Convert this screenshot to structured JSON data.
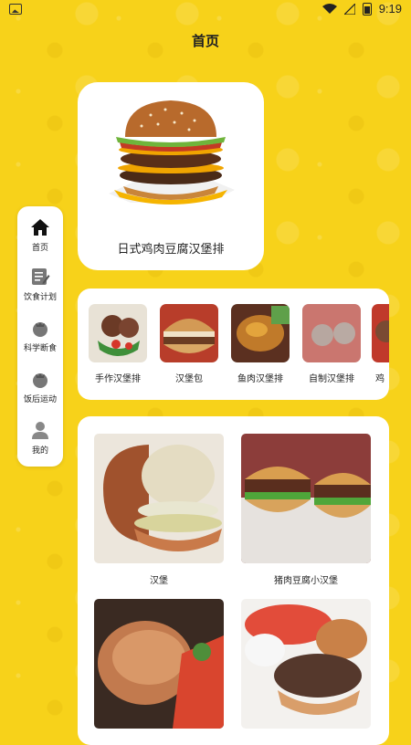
{
  "status_bar": {
    "time": "9:19"
  },
  "header": {
    "title": "首页"
  },
  "sidebar": {
    "items": [
      {
        "label": "首页",
        "icon": "home-icon"
      },
      {
        "label": "饮食计划",
        "icon": "notes-icon"
      },
      {
        "label": "科学断食",
        "icon": "tomato-icon"
      },
      {
        "label": "饭后运动",
        "icon": "tomato-icon"
      },
      {
        "label": "我的",
        "icon": "person-icon"
      }
    ]
  },
  "featured": {
    "caption": "日式鸡肉豆腐汉堡排"
  },
  "categories": [
    {
      "label": "手作汉堡排"
    },
    {
      "label": "汉堡包"
    },
    {
      "label": "鱼肉汉堡排"
    },
    {
      "label": "自制汉堡排"
    },
    {
      "label": "鸡"
    }
  ],
  "grid_items": [
    {
      "label": "汉堡"
    },
    {
      "label": "猪肉豆腐小汉堡"
    },
    {
      "label": ""
    },
    {
      "label": ""
    }
  ],
  "colors": {
    "background": "#F7D21A",
    "card": "#FFFFFF",
    "text": "#222222"
  }
}
